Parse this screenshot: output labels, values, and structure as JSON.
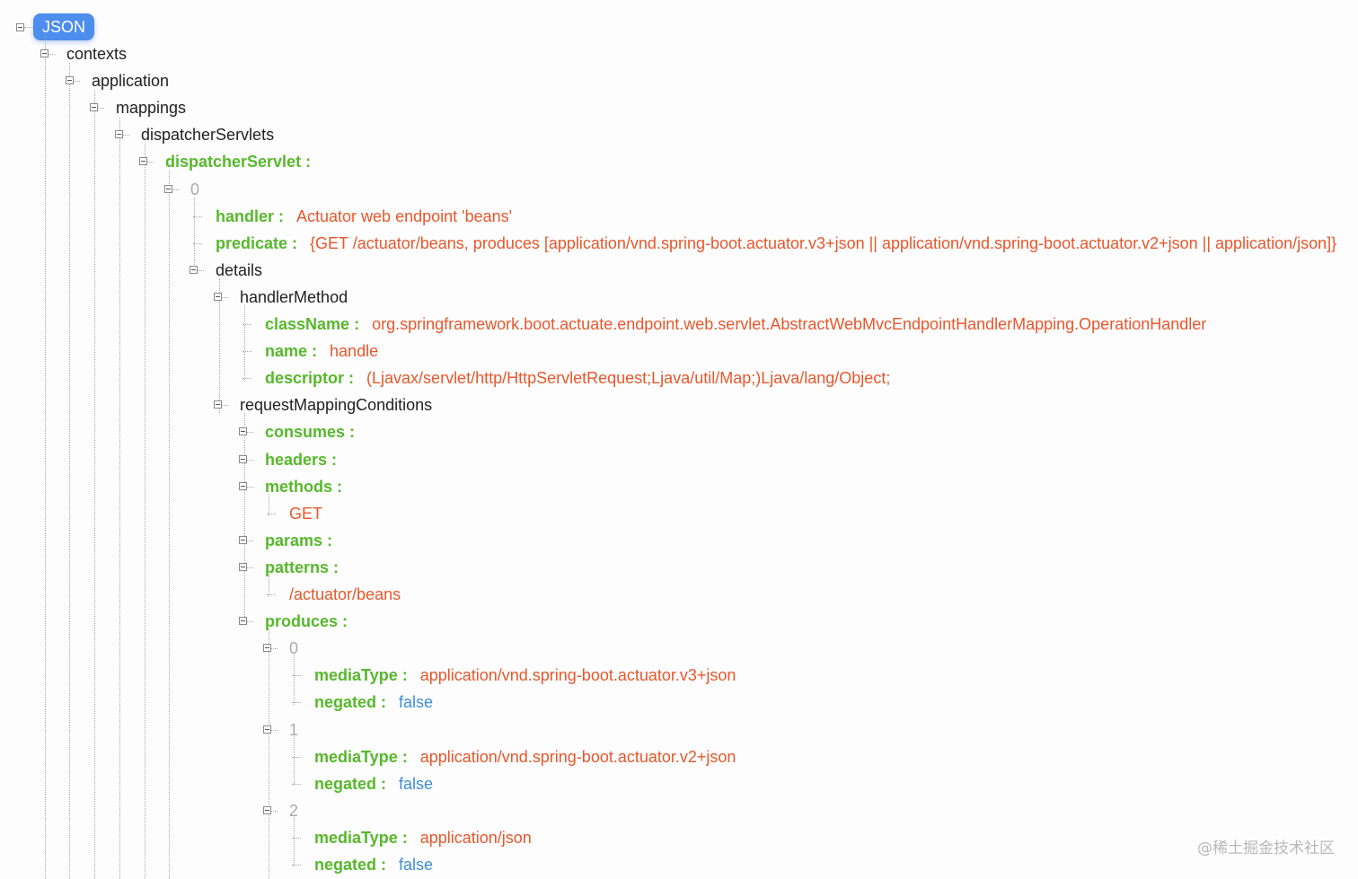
{
  "root": {
    "label": "JSON"
  },
  "nodes": [
    {
      "label": "contexts",
      "type": "plain"
    },
    {
      "label": "application",
      "type": "plain"
    },
    {
      "label": "mappings",
      "type": "plain"
    },
    {
      "label": "dispatcherServlets",
      "type": "plain"
    },
    {
      "label": "dispatcherServlet :",
      "type": "key"
    },
    {
      "label": "0",
      "type": "index"
    },
    {
      "label": "handler :",
      "type": "key",
      "value": "Actuator web endpoint 'beans'"
    },
    {
      "label": "predicate :",
      "type": "key",
      "value": "{GET /actuator/beans, produces [application/vnd.spring-boot.actuator.v3+json || application/vnd.spring-boot.actuator.v2+json || application/json]}"
    },
    {
      "label": "details",
      "type": "plain"
    },
    {
      "label": "handlerMethod",
      "type": "plain"
    },
    {
      "label": "className :",
      "type": "key",
      "value": "org.springframework.boot.actuate.endpoint.web.servlet.AbstractWebMvcEndpointHandlerMapping.OperationHandler"
    },
    {
      "label": "name :",
      "type": "key",
      "value": "handle"
    },
    {
      "label": "descriptor :",
      "type": "key",
      "value": "(Ljavax/servlet/http/HttpServletRequest;Ljava/util/Map;)Ljava/lang/Object;"
    },
    {
      "label": "requestMappingConditions",
      "type": "plain"
    },
    {
      "label": "consumes :",
      "type": "key"
    },
    {
      "label": "headers :",
      "type": "key"
    },
    {
      "label": "methods :",
      "type": "key"
    },
    {
      "label": "GET",
      "type": "bare"
    },
    {
      "label": "params :",
      "type": "key"
    },
    {
      "label": "patterns :",
      "type": "key"
    },
    {
      "label": "/actuator/beans",
      "type": "bare"
    },
    {
      "label": "produces :",
      "type": "key"
    },
    {
      "label": "0",
      "type": "index"
    },
    {
      "label": "mediaType :",
      "type": "key",
      "value": "application/vnd.spring-boot.actuator.v3+json"
    },
    {
      "label": "negated :",
      "type": "key",
      "value": "false",
      "bool": true
    },
    {
      "label": "1",
      "type": "index"
    },
    {
      "label": "mediaType :",
      "type": "key",
      "value": "application/vnd.spring-boot.actuator.v2+json"
    },
    {
      "label": "negated :",
      "type": "key",
      "value": "false",
      "bool": true
    },
    {
      "label": "2",
      "type": "index"
    },
    {
      "label": "mediaType :",
      "type": "key",
      "value": "application/json"
    },
    {
      "label": "negated :",
      "type": "key",
      "value": "false",
      "bool": true
    }
  ],
  "watermark": "@稀土掘金技术社区",
  "colors": {
    "key": "#57b82b",
    "string": "#e8572b",
    "boolean": "#3d8ed6",
    "badge": "#4c8dee"
  }
}
